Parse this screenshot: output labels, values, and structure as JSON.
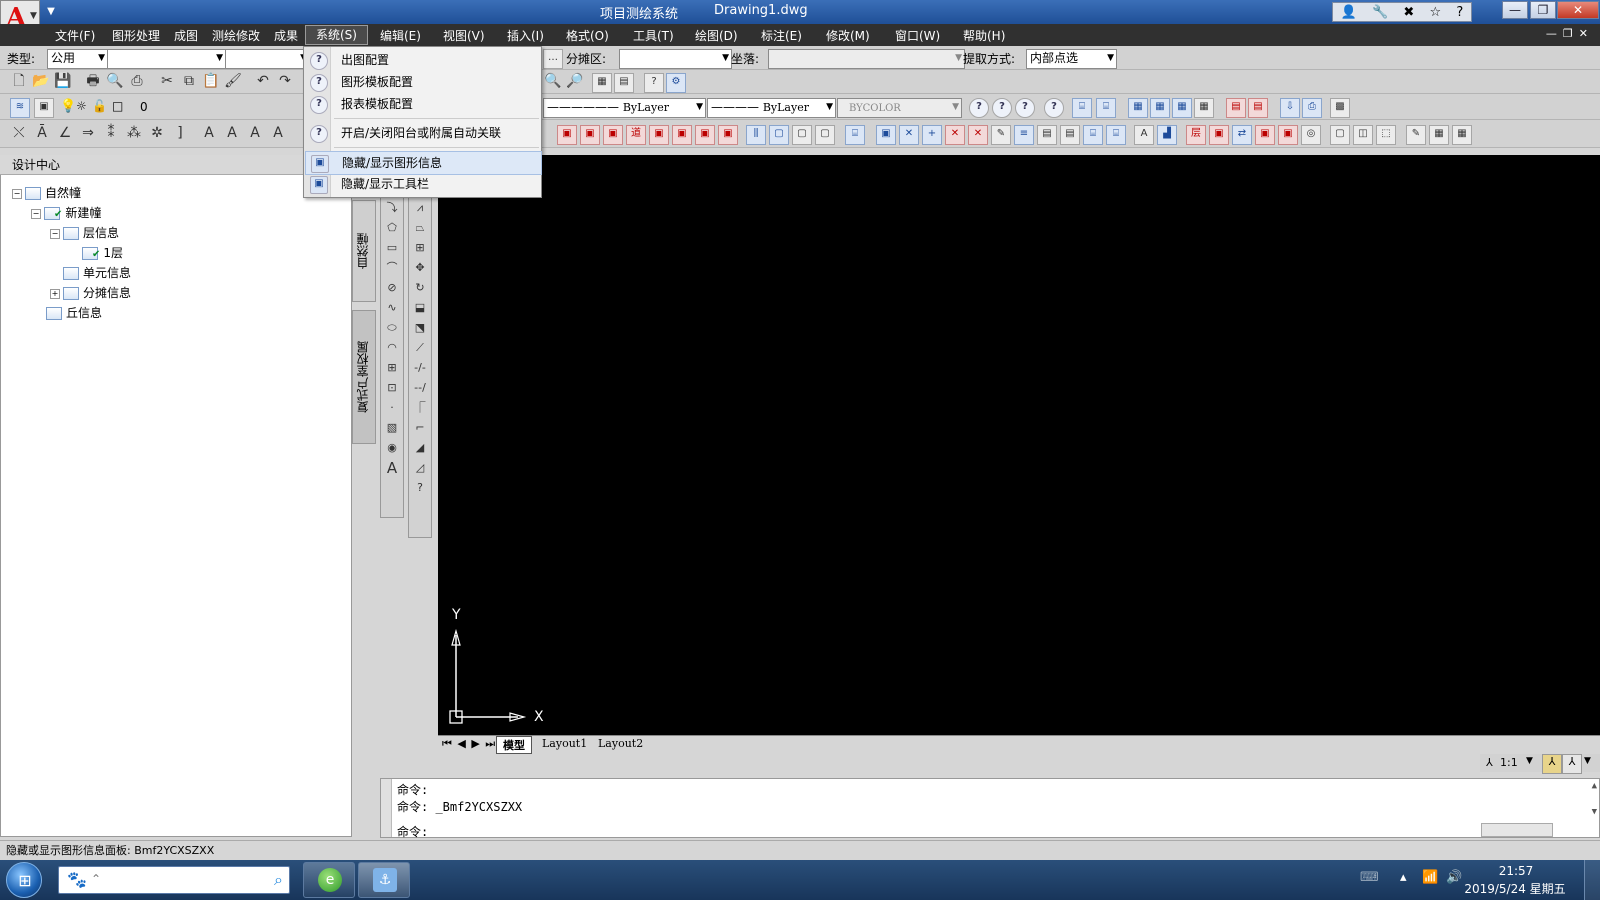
{
  "titlebar": {
    "app_title": "项目测绘系统",
    "file_name": "Drawing1.dwg",
    "app_logo_letter": "A",
    "tools": [
      "👤",
      "🔧",
      "✖",
      "☆",
      "?"
    ],
    "win_buttons": [
      "—",
      "❐",
      "✕"
    ]
  },
  "menubar": {
    "items": [
      "文件(F)",
      "图形处理",
      "成图",
      "测绘修改",
      "成果",
      "系统(S)",
      "编辑(E)",
      "视图(V)",
      "插入(I)",
      "格式(O)",
      "工具(T)",
      "绘图(D)",
      "标注(E)",
      "修改(M)",
      "窗口(W)",
      "帮助(H)"
    ],
    "active_index": 5,
    "mdi_buttons": "—❐✕"
  },
  "toolbar1": {
    "type_label": "类型:",
    "type_value": "公用",
    "combo2_value": "",
    "combo3_value": "",
    "fentan_label": "分摊区:",
    "fentan_value": "",
    "zuoluo_label": "坐落:",
    "zuoluo_value": "",
    "extract_label": "提取方式:",
    "extract_value": "内部点选"
  },
  "toolbar3": {
    "layer_value": "0",
    "linetype_value": "ByLayer",
    "lineweight_value": "ByLayer",
    "color_value": "BYCOLOR"
  },
  "dropdown": {
    "items": [
      {
        "label": "出图配置",
        "icon": "?"
      },
      {
        "label": "图形模板配置",
        "icon": "?"
      },
      {
        "label": "报表模板配置",
        "icon": "?"
      },
      {
        "label": "开启/关闭阳台或附属自动关联",
        "icon": "?"
      },
      {
        "label": "隐藏/显示图形信息",
        "icon": "▣"
      },
      {
        "label": "隐藏/显示工具栏",
        "icon": "▣"
      }
    ],
    "highlighted_index": 4
  },
  "design_center": {
    "title": "设计中心",
    "tree": [
      {
        "label": "自然幢",
        "toggle": "−"
      },
      {
        "label": "新建幢",
        "toggle": "−"
      },
      {
        "label": "层信息",
        "toggle": "−"
      },
      {
        "label": "1层",
        "toggle": ""
      },
      {
        "label": "单元信息",
        "toggle": ""
      },
      {
        "label": "分摊信息",
        "toggle": "+"
      },
      {
        "label": "丘信息",
        "toggle": ""
      }
    ],
    "vtab_top": "自然幢",
    "vtab_bottom": "复式户室权属"
  },
  "canvas": {
    "y_axis_label": "Y",
    "x_axis_label": "X"
  },
  "layout_tabs": {
    "nav": "⏮ ◀ ▶ ⏭",
    "tabs": [
      "模型",
      "Layout1",
      "Layout2"
    ]
  },
  "scale": {
    "value": "1:1"
  },
  "command": {
    "lines": [
      "命令:",
      "命令: _Bmf2YCXSZXX",
      "命令:"
    ]
  },
  "statusbar": {
    "text": "隐藏或显示图形信息面板: Bmf2YCXSZXX"
  },
  "taskbar": {
    "search_placeholder": "",
    "clock_time": "21:57",
    "clock_date": "2019/5/24 星期五"
  },
  "colors": {
    "canvas_bg": "#000000",
    "menubar_bg": "#303030",
    "taskbar_bg": "#18355a",
    "accent": "#1f4f97"
  }
}
